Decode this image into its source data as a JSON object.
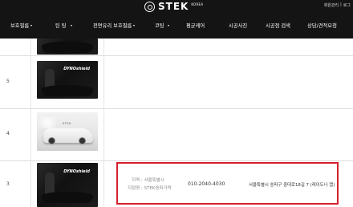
{
  "header": {
    "brand": "STEK",
    "brand_sub": "KOREA",
    "util_links": [
      "회원관리",
      "|",
      "로그"
    ],
    "colors": {
      "background": "#141414",
      "text": "#ffffff",
      "highlight": "#d4202c"
    }
  },
  "nav": {
    "items": [
      {
        "label": "보호필름",
        "has_dropdown": true
      },
      {
        "label": "틴 팅",
        "has_dropdown": true
      },
      {
        "label": "전면유리 보호필름",
        "has_dropdown": true
      },
      {
        "label": "코팅",
        "has_dropdown": true
      },
      {
        "label": "평균케어",
        "has_dropdown": false
      },
      {
        "label": "시공사진",
        "has_dropdown": false
      },
      {
        "label": "시공점 검색",
        "has_dropdown": false
      },
      {
        "label": "상담/견적요청",
        "has_dropdown": false
      }
    ]
  },
  "table": {
    "rows": [
      {
        "number": "",
        "thumbnail": "dyno-dark-partial"
      },
      {
        "number": "5",
        "thumbnail": "dyno-dark",
        "tag": "DYNOshield"
      },
      {
        "number": "4",
        "thumbnail": "white-car"
      },
      {
        "number": "3",
        "thumbnail": "dyno-dark",
        "tag": "DYNOshield",
        "region_label": "지역 : 서울특별시",
        "store_label": "지점명 : STEK송파가락",
        "phone": "010-2040-4030",
        "address": "서울특별시 송파구 중대로18길 7 (레이도나 캡)"
      }
    ]
  }
}
